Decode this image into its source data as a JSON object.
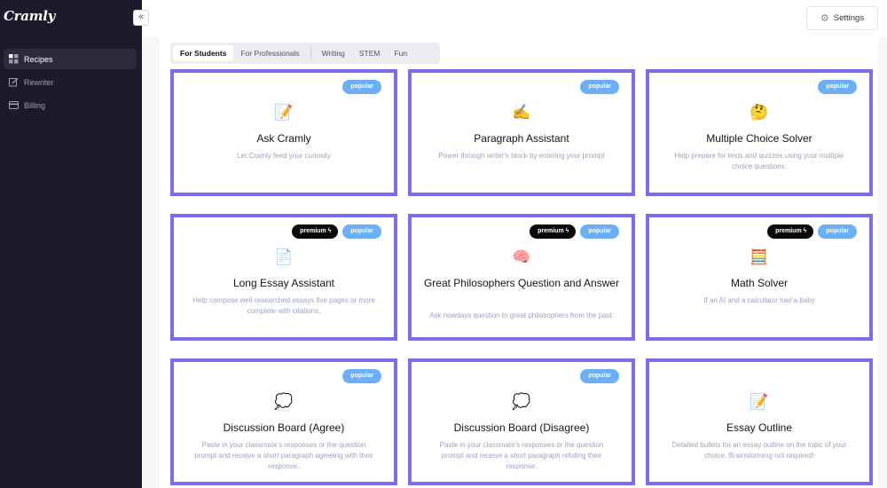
{
  "sidebar": {
    "logo": "Cramly",
    "collapse_icon": "«",
    "items": [
      {
        "label": "Recipes",
        "icon": "grid-icon",
        "active": true
      },
      {
        "label": "Rewriter",
        "icon": "edit-icon",
        "active": false
      },
      {
        "label": "Billing",
        "icon": "card-icon",
        "active": false
      }
    ]
  },
  "header": {
    "settings_label": "Settings",
    "settings_icon": "gear-icon"
  },
  "tabs": [
    {
      "label": "For Students",
      "active": true
    },
    {
      "label": "For Professionals",
      "active": false
    },
    {
      "label": "Writing",
      "active": false
    },
    {
      "label": "STEM",
      "active": false
    },
    {
      "label": "Fun",
      "active": false
    }
  ],
  "badge_labels": {
    "premium": "premium ϟ",
    "popular": "popular"
  },
  "cards": [
    {
      "emoji": "📝",
      "title": "Ask Cramly",
      "desc": "Let Cramly feed your curiosity",
      "premium": false,
      "popular": true
    },
    {
      "emoji": "✍️",
      "title": "Paragraph Assistant",
      "desc": "Power through writer's block by entering your prompt",
      "premium": false,
      "popular": true
    },
    {
      "emoji": "🤔",
      "title": "Multiple Choice Solver",
      "desc": "Help prepare for tests and quizzes using your multiple choice questions.",
      "premium": false,
      "popular": true
    },
    {
      "emoji": "📄",
      "title": "Long Essay Assistant",
      "desc": "Help compose well-researched essays five pages or more complete with citations.",
      "premium": true,
      "popular": true
    },
    {
      "emoji": "🧠",
      "title": "Great Philosophers Question and Answer",
      "desc": "Ask nowdays question to great philosophers from the past.",
      "premium": true,
      "popular": true
    },
    {
      "emoji": "🧮",
      "title": "Math Solver",
      "desc": "If an AI and a calculator had a baby",
      "premium": true,
      "popular": true
    },
    {
      "emoji": "💭",
      "title": "Discussion Board (Agree)",
      "desc": "Paste in your classmate's responses or the question prompt and receive a short paragraph agreeing with their response.",
      "premium": false,
      "popular": true
    },
    {
      "emoji": "💭",
      "title": "Discussion Board (Disagree)",
      "desc": "Paste in your classmate's responses or the question prompt and receive a short paragraph refuting their response.",
      "premium": false,
      "popular": true
    },
    {
      "emoji": "📝",
      "title": "Essay Outline",
      "desc": "Detailed bullets for an essay outline on the topic of your choice. Brainstorming not required!",
      "premium": false,
      "popular": false
    }
  ],
  "colors": {
    "accent_border": "#7c6cf0",
    "popular_badge": "#6aaff7",
    "premium_badge": "#0a0a0a",
    "sidebar_bg": "#1c1b2b"
  }
}
